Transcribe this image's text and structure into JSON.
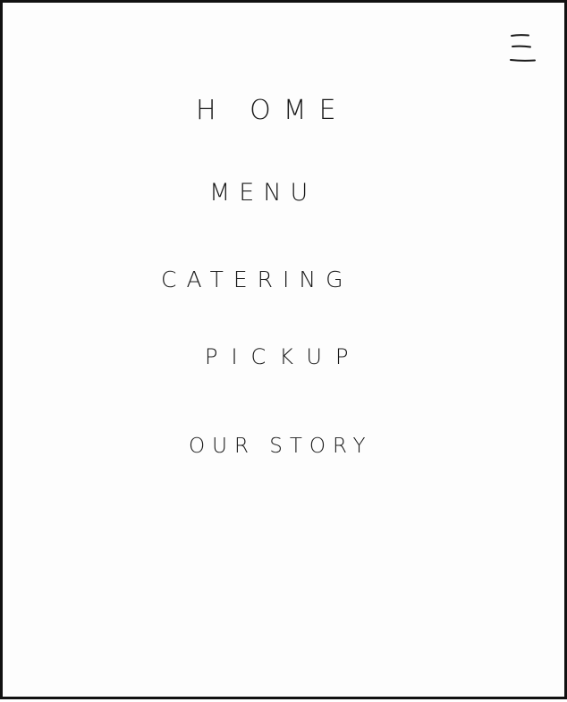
{
  "header": {
    "menu_icon": "hamburger-icon"
  },
  "nav": {
    "items": [
      {
        "label": "H OME"
      },
      {
        "label": "MENU"
      },
      {
        "label": "CATERING"
      },
      {
        "label": "PICKUP"
      },
      {
        "label": "OUR STORY"
      }
    ]
  },
  "colors": {
    "ink": "#1a1a1a",
    "paper": "#fdfdfd",
    "border": "#111111"
  }
}
